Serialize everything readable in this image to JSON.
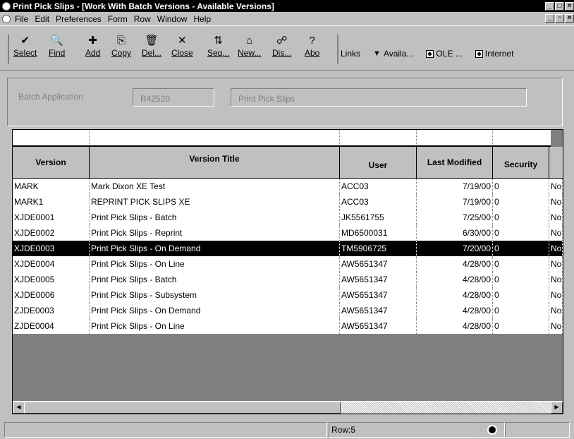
{
  "window": {
    "title": "Print Pick Slips - [Work With Batch Versions - Available Versions]",
    "controls": [
      "_",
      "□",
      "×"
    ]
  },
  "menu": {
    "items": [
      {
        "id": "file",
        "label": "File"
      },
      {
        "id": "edit",
        "label": "Edit"
      },
      {
        "id": "preferences",
        "label": "Preferences"
      },
      {
        "id": "form",
        "label": "Form"
      },
      {
        "id": "row",
        "label": "Row"
      },
      {
        "id": "window",
        "label": "Window"
      },
      {
        "id": "help",
        "label": "Help"
      }
    ],
    "mdi_controls": [
      "_",
      "▫",
      "×"
    ]
  },
  "toolbar": {
    "buttons": [
      {
        "id": "select",
        "label": "Select",
        "icon": "check-icon",
        "glyph": "✔"
      },
      {
        "id": "find",
        "label": "Find",
        "icon": "find-icon",
        "glyph": "🔍"
      },
      {
        "id": "add",
        "label": "Add",
        "icon": "add-icon",
        "glyph": "✚"
      },
      {
        "id": "copy",
        "label": "Copy",
        "icon": "copy-icon",
        "glyph": "⎘"
      },
      {
        "id": "delete",
        "label": "Del...",
        "icon": "trash-icon",
        "glyph": "🗑"
      },
      {
        "id": "close",
        "label": "Close",
        "icon": "close-icon",
        "glyph": "✕"
      },
      {
        "id": "seq",
        "label": "Seq...",
        "icon": "sequence-icon",
        "glyph": "⇅"
      },
      {
        "id": "new",
        "label": "New...",
        "icon": "new-icon",
        "glyph": "⌂"
      },
      {
        "id": "dis",
        "label": "Dis...",
        "icon": "display-icon",
        "glyph": "☍"
      },
      {
        "id": "abo",
        "label": "Abo",
        "icon": "about-icon",
        "glyph": "?"
      }
    ],
    "links_label": "Links",
    "availa_label": "Availa...",
    "ole_label": "OLE ...",
    "internet_label": "Internet"
  },
  "header": {
    "batch_app_label": "Batch Application",
    "batch_app_value": "R42520",
    "batch_app_desc": "Print Pick Slips"
  },
  "grid": {
    "columns": [
      {
        "id": "version",
        "label": "Version"
      },
      {
        "id": "title",
        "label": "Version Title"
      },
      {
        "id": "user",
        "label": "User"
      },
      {
        "id": "modified",
        "label": "Last Modified"
      },
      {
        "id": "security",
        "label": "Security"
      }
    ],
    "rows": [
      {
        "version": "MARK",
        "title": "Mark Dixon XE Test",
        "user": "ACC03",
        "modified": "7/19/00",
        "security": "0",
        "extra": "No",
        "selected": false
      },
      {
        "version": "MARK1",
        "title": "REPRINT PICK SLIPS XE",
        "user": "ACC03",
        "modified": "7/19/00",
        "security": "0",
        "extra": "No",
        "selected": false
      },
      {
        "version": "XJDE0001",
        "title": "Print Pick Slips - Batch",
        "user": "JK5561755",
        "modified": "7/25/00",
        "security": "0",
        "extra": "No",
        "selected": false
      },
      {
        "version": "XJDE0002",
        "title": "Print Pick Slips - Reprint",
        "user": "MD6500031",
        "modified": "6/30/00",
        "security": "0",
        "extra": "No",
        "selected": false
      },
      {
        "version": "XJDE0003",
        "title": "Print Pick Slips - On Demand",
        "user": "TM5906725",
        "modified": "7/20/00",
        "security": "0",
        "extra": "No",
        "selected": true
      },
      {
        "version": "XJDE0004",
        "title": "Print Pick Slips - On Line",
        "user": "AW5651347",
        "modified": "4/28/00",
        "security": "0",
        "extra": "No",
        "selected": false
      },
      {
        "version": "XJDE0005",
        "title": "Print Pick Slips - Batch",
        "user": "AW5651347",
        "modified": "4/28/00",
        "security": "0",
        "extra": "No",
        "selected": false
      },
      {
        "version": "XJDE0006",
        "title": "Print Pick Slips - Subsystem",
        "user": "AW5651347",
        "modified": "4/28/00",
        "security": "0",
        "extra": "No",
        "selected": false
      },
      {
        "version": "ZJDE0003",
        "title": "Print Pick Slips - On Demand",
        "user": "AW5651347",
        "modified": "4/28/00",
        "security": "0",
        "extra": "No",
        "selected": false
      },
      {
        "version": "ZJDE0004",
        "title": "Print Pick Slips - On Line",
        "user": "AW5651347",
        "modified": "4/28/00",
        "security": "0",
        "extra": "No",
        "selected": false
      }
    ]
  },
  "status": {
    "row_text": "Row:5"
  }
}
